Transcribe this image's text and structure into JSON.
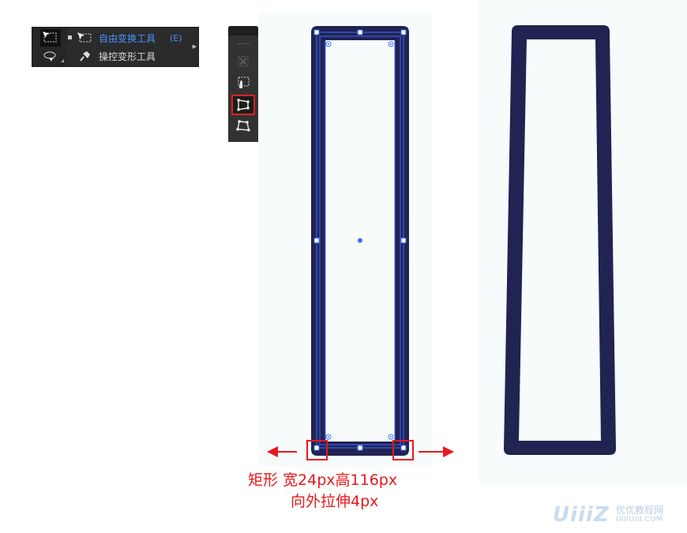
{
  "flyout_menu": {
    "items": [
      {
        "label": "自由变换工具",
        "shortcut": "(E)",
        "icon": "free-transform-icon",
        "selected": true
      },
      {
        "label": "操控变形工具",
        "shortcut": "",
        "icon": "puppet-warp-pin-icon",
        "selected": false
      }
    ]
  },
  "toolbar_panel": {
    "tools": [
      {
        "name": "constrain-icon",
        "selected": false
      },
      {
        "name": "free-transform-icon",
        "selected": false
      },
      {
        "name": "perspective-distort-icon",
        "selected": true
      },
      {
        "name": "free-distort-icon",
        "selected": false
      }
    ]
  },
  "annotation": {
    "line1": "矩形 宽24px高116px",
    "line2": "向外拉伸4px"
  },
  "watermark": {
    "logo": "UiiiZ",
    "name_cn": "优优教程网",
    "url": "UIIIUIII.COM"
  },
  "colors": {
    "shape_fill": "#212352",
    "selection": "#3d6bff",
    "annotation": "#e8181c",
    "canvas_bg": "#f7fbfc"
  }
}
